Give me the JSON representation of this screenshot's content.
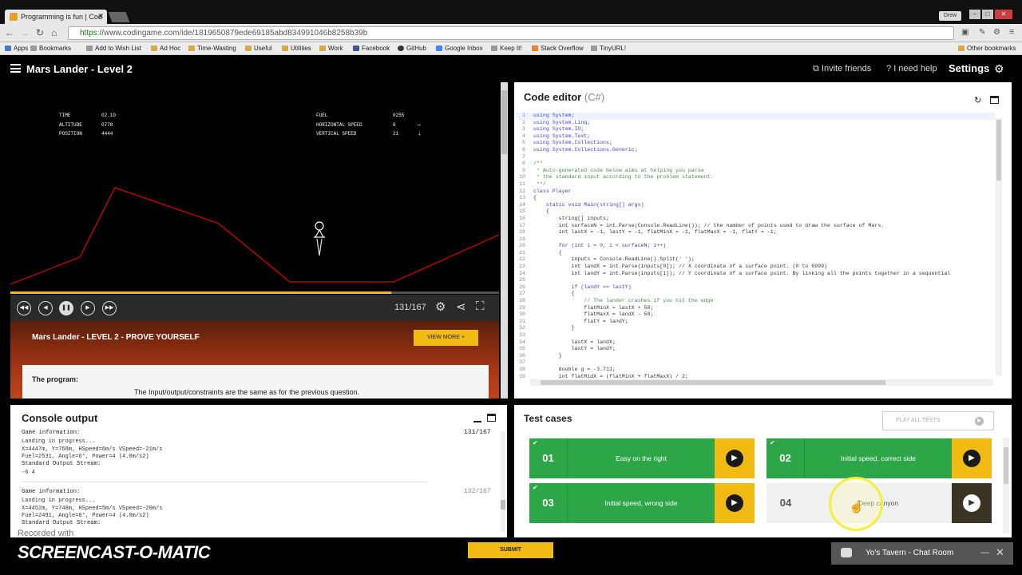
{
  "browser": {
    "tab_title": "Programming is fun | Cod",
    "user_badge": "Drew",
    "url_scheme": "https://",
    "url_rest": "www.codingame.com/ide/1819650879ede69185abd834991046b8258b39b",
    "bookmarks": [
      "Apps",
      "Bookmarks",
      "Add to Wish List",
      "Ad Hoc",
      "Time-Wasting",
      "Useful",
      "Utilities",
      "Work",
      "Facebook",
      "GitHub",
      "Google Inbox",
      "Keep It!",
      "Stack Overflow",
      "TinyURL!"
    ],
    "other_bookmarks": "Other bookmarks"
  },
  "header": {
    "title": "Mars Lander - Level 2",
    "invite": "Invite friends",
    "help": "I need help",
    "settings": "Settings"
  },
  "hud": {
    "time_label": "TIME",
    "time": "02.10",
    "altitude_label": "ALTITUDE",
    "altitude": "0778",
    "position_label": "POSITION",
    "position": "4444",
    "fuel_label": "FUEL",
    "fuel": "0255",
    "hspeed_label": "HORIZONTAL SPEED",
    "hspeed": "6",
    "hspeed_arrow": "→",
    "vspeed_label": "VERTICAL SPEED",
    "vspeed": "21",
    "vspeed_arrow": "↓"
  },
  "playback": {
    "frame": "131/167",
    "progress": 0.78
  },
  "banner": {
    "title": "Mars Lander - LEVEL 2 - PROVE YOURSELF",
    "view_more": "VIEW MORE +",
    "program_label": "The program:",
    "program_text": "The Input/output/constraints are the same as for the previous question."
  },
  "editor": {
    "title": "Code editor",
    "lang": "(C#)",
    "lines": [
      {
        "n": "1",
        "t": "using System;",
        "c": "kw"
      },
      {
        "n": "2",
        "t": "using System.Linq;",
        "c": "kw"
      },
      {
        "n": "3",
        "t": "using System.IO;",
        "c": "kw"
      },
      {
        "n": "4",
        "t": "using System.Text;",
        "c": "kw"
      },
      {
        "n": "5",
        "t": "using System.Collections;",
        "c": "kw"
      },
      {
        "n": "6",
        "t": "using System.Collections.Generic;",
        "c": "kw"
      },
      {
        "n": "7",
        "t": "",
        "c": "tx"
      },
      {
        "n": "8",
        "t": "/**",
        "c": "cm"
      },
      {
        "n": "9",
        "t": " * Auto-generated code below aims at helping you parse",
        "c": "cm"
      },
      {
        "n": "10",
        "t": " * the standard input according to the problem statement.",
        "c": "cm"
      },
      {
        "n": "11",
        "t": " **/",
        "c": "cm"
      },
      {
        "n": "12",
        "t": "class Player",
        "c": "kw"
      },
      {
        "n": "13",
        "t": "{",
        "c": "tx"
      },
      {
        "n": "14",
        "t": "    static void Main(string[] args)",
        "c": "kw"
      },
      {
        "n": "15",
        "t": "    {",
        "c": "tx"
      },
      {
        "n": "16",
        "t": "        string[] inputs;",
        "c": "tx"
      },
      {
        "n": "17",
        "t": "        int surfaceN = int.Parse(Console.ReadLine()); // the number of points used to draw the surface of Mars.",
        "c": "tx"
      },
      {
        "n": "18",
        "t": "        int lastX = -1, lastY = -1, flatMinX = -1, flatMaxX = -1, flatY = -1;",
        "c": "tx"
      },
      {
        "n": "19",
        "t": "",
        "c": "tx"
      },
      {
        "n": "20",
        "t": "        for (int i = 0; i < surfaceN; i++)",
        "c": "kw"
      },
      {
        "n": "21",
        "t": "        {",
        "c": "tx"
      },
      {
        "n": "22",
        "t": "            inputs = Console.ReadLine().Split(' ');",
        "c": "tx"
      },
      {
        "n": "23",
        "t": "            int landX = int.Parse(inputs[0]); // X coordinate of a surface point. (0 to 6999)",
        "c": "tx"
      },
      {
        "n": "24",
        "t": "            int landY = int.Parse(inputs[1]); // Y coordinate of a surface point. By linking all the points together in a sequential",
        "c": "tx"
      },
      {
        "n": "25",
        "t": "",
        "c": "tx"
      },
      {
        "n": "26",
        "t": "            if (landY == lastY)",
        "c": "kw"
      },
      {
        "n": "27",
        "t": "            {",
        "c": "tx"
      },
      {
        "n": "28",
        "t": "                // The lander crashes if you hit the edge",
        "c": "cm"
      },
      {
        "n": "29",
        "t": "                flatMinX = lastX + 50;",
        "c": "tx"
      },
      {
        "n": "30",
        "t": "                flatMaxX = landX - 50;",
        "c": "tx"
      },
      {
        "n": "31",
        "t": "                flatY = landY;",
        "c": "tx"
      },
      {
        "n": "32",
        "t": "            }",
        "c": "tx"
      },
      {
        "n": "33",
        "t": "",
        "c": "tx"
      },
      {
        "n": "34",
        "t": "            lastX = landX;",
        "c": "tx"
      },
      {
        "n": "35",
        "t": "            lastY = landY;",
        "c": "tx"
      },
      {
        "n": "36",
        "t": "        }",
        "c": "tx"
      },
      {
        "n": "37",
        "t": "",
        "c": "tx"
      },
      {
        "n": "38",
        "t": "        double g = -3.711;",
        "c": "tx"
      },
      {
        "n": "39",
        "t": "        int flatMidX = (flatMinX + flatMaxX) / 2;",
        "c": "tx"
      },
      {
        "n": "40",
        "t": "",
        "c": "tx"
      }
    ]
  },
  "console": {
    "title": "Console output",
    "block1": {
      "header": "Game information:",
      "count": "131/167",
      "lines": "Landing in progress...\nX=4447m, Y=768m, HSpeed=6m/s VSpeed=-21m/s\nFuel=2531, Angle=6°, Power=4 (4.0m/s2)",
      "stream_label": "Standard Output Stream:",
      "output": "-6 4"
    },
    "block2": {
      "header": "Game information:",
      "count": "132/167",
      "lines": "Landing in progress...\nX=4452m, Y=748m, HSpeed=5m/s VSpeed=-20m/s\nFuel=2491, Angle=6°, Power=4 (4.0m/s2)",
      "stream_label": "Standard Output Stream:"
    }
  },
  "tests": {
    "title": "Test cases",
    "play_all": "PLAY ALL TESTS",
    "cases": [
      {
        "num": "01",
        "name": "Easy on the right",
        "status": "pass"
      },
      {
        "num": "02",
        "name": "Initial speed, correct side",
        "status": "pass"
      },
      {
        "num": "03",
        "name": "Initial speed, wrong side",
        "status": "pass"
      },
      {
        "num": "04",
        "name": "Deep canyon",
        "status": "pending"
      }
    ]
  },
  "footer": {
    "submit": "SUBMIT",
    "recorded": "Recorded with",
    "logo": "SCREENCAST-O-MATIC",
    "chat_title": "Yo's Tavern - Chat Room"
  },
  "colors": {
    "accent": "#f2bb13",
    "pass": "#2ca646",
    "terrain": "#e00000"
  }
}
